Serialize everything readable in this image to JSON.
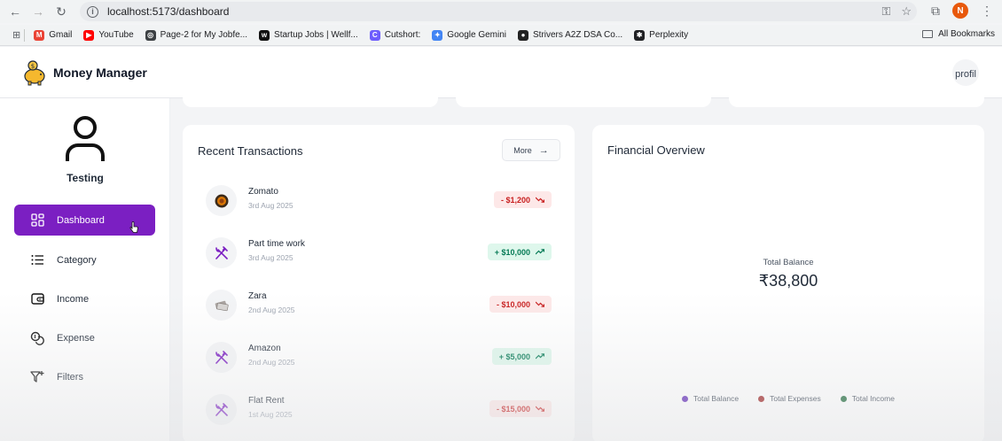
{
  "browser": {
    "url": "localhost:5173/dashboard",
    "profile_initial": "N",
    "bookmarks": [
      {
        "label": "Gmail",
        "icon": "gmail-icon",
        "color": "#ea4335",
        "glyph": "M"
      },
      {
        "label": "YouTube",
        "icon": "youtube-icon",
        "color": "#ff0000",
        "glyph": "▶"
      },
      {
        "label": "Page-2 for My Jobfe...",
        "icon": "globe-icon",
        "color": "#3c4043",
        "glyph": "◎"
      },
      {
        "label": "Startup Jobs | Wellf...",
        "icon": "wellfound-icon",
        "color": "#111111",
        "glyph": "w"
      },
      {
        "label": "Cutshort:",
        "icon": "cutshort-icon",
        "color": "#6d5dfc",
        "glyph": "C"
      },
      {
        "label": "Google Gemini",
        "icon": "gemini-icon",
        "color": "#4285f4",
        "glyph": "✦"
      },
      {
        "label": "Strivers A2Z DSA Co...",
        "icon": "striver-icon",
        "color": "#222222",
        "glyph": "●"
      },
      {
        "label": "Perplexity",
        "icon": "perplexity-icon",
        "color": "#202124",
        "glyph": "✱"
      }
    ],
    "all_bookmarks": "All Bookmarks"
  },
  "app": {
    "title": "Money Manager",
    "profile_alt": "profil"
  },
  "sidebar": {
    "user_name": "Testing",
    "items": [
      {
        "label": "Dashboard",
        "icon": "dashboard-grid-icon",
        "active": true
      },
      {
        "label": "Category",
        "icon": "list-icon",
        "active": false
      },
      {
        "label": "Income",
        "icon": "wallet-icon",
        "active": false
      },
      {
        "label": "Expense",
        "icon": "coins-icon",
        "active": false
      },
      {
        "label": "Filters",
        "icon": "filter-icon",
        "active": false
      }
    ]
  },
  "recent_transactions": {
    "title": "Recent Transactions",
    "more_label": "More",
    "items": [
      {
        "name": "Zomato",
        "date": "3rd Aug 2025",
        "amount": "- $1,200",
        "type": "expense",
        "icon": "food-plate-icon"
      },
      {
        "name": "Part time work",
        "date": "3rd Aug 2025",
        "amount": "+ $10,000",
        "type": "income",
        "icon": "utensils-cross-icon"
      },
      {
        "name": "Zara",
        "date": "2nd Aug 2025",
        "amount": "- $10,000",
        "type": "expense",
        "icon": "money-notes-icon"
      },
      {
        "name": "Amazon",
        "date": "2nd Aug 2025",
        "amount": "+ $5,000",
        "type": "income",
        "icon": "utensils-cross-icon"
      },
      {
        "name": "Flat Rent",
        "date": "1st Aug 2025",
        "amount": "- $15,000",
        "type": "expense",
        "icon": "utensils-cross-icon"
      }
    ]
  },
  "financial_overview": {
    "title": "Financial Overview",
    "total_balance_label": "Total Balance",
    "total_balance_value": "₹38,800",
    "legend": [
      {
        "label": "Total Balance",
        "color": "#5b21b6"
      },
      {
        "label": "Total Expenses",
        "color": "#9b1c1c"
      },
      {
        "label": "Total Income",
        "color": "#166534"
      }
    ]
  }
}
